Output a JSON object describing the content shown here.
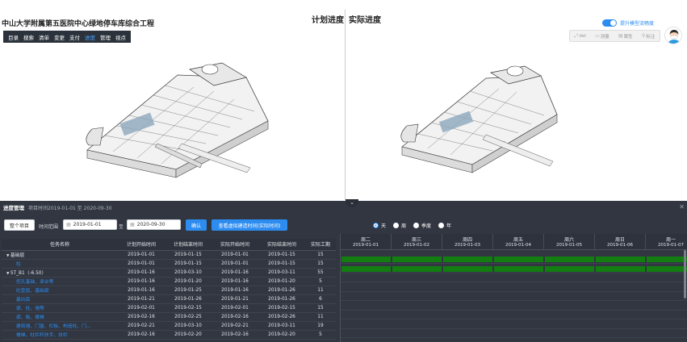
{
  "project": {
    "title": "中山大学附属第五医院中心绿地停车库综合工程"
  },
  "menu": [
    {
      "label": "目录",
      "active": false
    },
    {
      "label": "搜索",
      "active": false
    },
    {
      "label": "清单",
      "active": false
    },
    {
      "label": "变更",
      "active": false
    },
    {
      "label": "支付",
      "active": false
    },
    {
      "label": "进度",
      "active": true
    },
    {
      "label": "管理",
      "active": false
    },
    {
      "label": "视点",
      "active": false
    }
  ],
  "views": {
    "planned": "计划进度",
    "actual": "实际进度"
  },
  "toggle": {
    "label": "提升模型流畅度",
    "on": true
  },
  "toolbox": [
    {
      "label": "del",
      "icon": "expand-icon"
    },
    {
      "label": "测量",
      "icon": "ruler-icon"
    },
    {
      "label": "属性",
      "icon": "properties-icon"
    },
    {
      "label": "标注",
      "icon": "marker-icon"
    }
  ],
  "panel": {
    "title": "进度管理",
    "subtitle": "项目时间2019-01-01 至 2020-09-30",
    "whole_project_button": "整个项目",
    "range_label": "时间范围",
    "date_from": "2019-01-01",
    "separator": "至",
    "date_to": "2020-09-30",
    "confirm_button": "确认",
    "compare_button": "查看虚拟建造时间(实际时间)",
    "scale_options": [
      {
        "label": "天",
        "checked": true
      },
      {
        "label": "周",
        "checked": false
      },
      {
        "label": "季度",
        "checked": false
      },
      {
        "label": "年",
        "checked": false
      }
    ]
  },
  "table": {
    "columns": [
      "任务名称",
      "计划开始时间",
      "计划结束时间",
      "实际开始时间",
      "实际结束时间",
      "实际工期"
    ],
    "rows": [
      {
        "name": "基础层",
        "ps": "2019-01-01",
        "pe": "2019-01-15",
        "as": "2019-01-01",
        "ae": "2019-01-15",
        "dur": "15",
        "type": "grp"
      },
      {
        "name": "柱",
        "ps": "2019-01-01",
        "pe": "2019-01-15",
        "as": "2019-01-01",
        "ae": "2019-01-15",
        "dur": "15",
        "type": "link"
      },
      {
        "name": "ST_B1（-6.50）",
        "ps": "2019-01-16",
        "pe": "2019-03-10",
        "as": "2019-01-16",
        "ae": "2019-03-11",
        "dur": "55",
        "type": "grp"
      },
      {
        "name": "挖孔基础、承台等",
        "ps": "2019-01-16",
        "pe": "2019-01-20",
        "as": "2019-01-16",
        "ae": "2019-01-20",
        "dur": "5",
        "type": "link"
      },
      {
        "name": "砼垫层、基础梁",
        "ps": "2019-01-16",
        "pe": "2019-01-25",
        "as": "2019-01-16",
        "ae": "2019-01-26",
        "dur": "11",
        "type": "link"
      },
      {
        "name": "基坑底",
        "ps": "2019-01-21",
        "pe": "2019-01-26",
        "as": "2019-01-21",
        "ae": "2019-01-26",
        "dur": "6",
        "type": "link"
      },
      {
        "name": "梁、柱、墙等",
        "ps": "2019-02-01",
        "pe": "2019-02-15",
        "as": "2019-02-01",
        "ae": "2019-02-15",
        "dur": "15",
        "type": "link"
      },
      {
        "name": "梁、板、楼梯",
        "ps": "2019-02-16",
        "pe": "2019-02-25",
        "as": "2019-02-16",
        "ae": "2019-02-26",
        "dur": "11",
        "type": "link"
      },
      {
        "name": "建筑墙、门窗、栏板、构造柱、门...",
        "ps": "2019-02-21",
        "pe": "2019-03-10",
        "as": "2019-02-21",
        "ae": "2019-03-11",
        "dur": "19",
        "type": "link"
      },
      {
        "name": "楼梯、柱栏杆扶手、扶栏",
        "ps": "2019-02-16",
        "pe": "2019-02-20",
        "as": "2019-02-16",
        "ae": "2019-02-20",
        "dur": "5",
        "type": "link"
      }
    ]
  },
  "gantt": {
    "days": [
      {
        "weekday": "周二",
        "date": "2019-01-01"
      },
      {
        "weekday": "周三",
        "date": "2019-01-02"
      },
      {
        "weekday": "周四",
        "date": "2019-01-03"
      },
      {
        "weekday": "周五",
        "date": "2019-01-04"
      },
      {
        "weekday": "周六",
        "date": "2019-01-05"
      },
      {
        "weekday": "周日",
        "date": "2019-01-06"
      },
      {
        "weekday": "周一",
        "date": "2019-01-07"
      }
    ],
    "bar_color": "#137d12",
    "bar_rows": [
      0,
      1
    ]
  }
}
